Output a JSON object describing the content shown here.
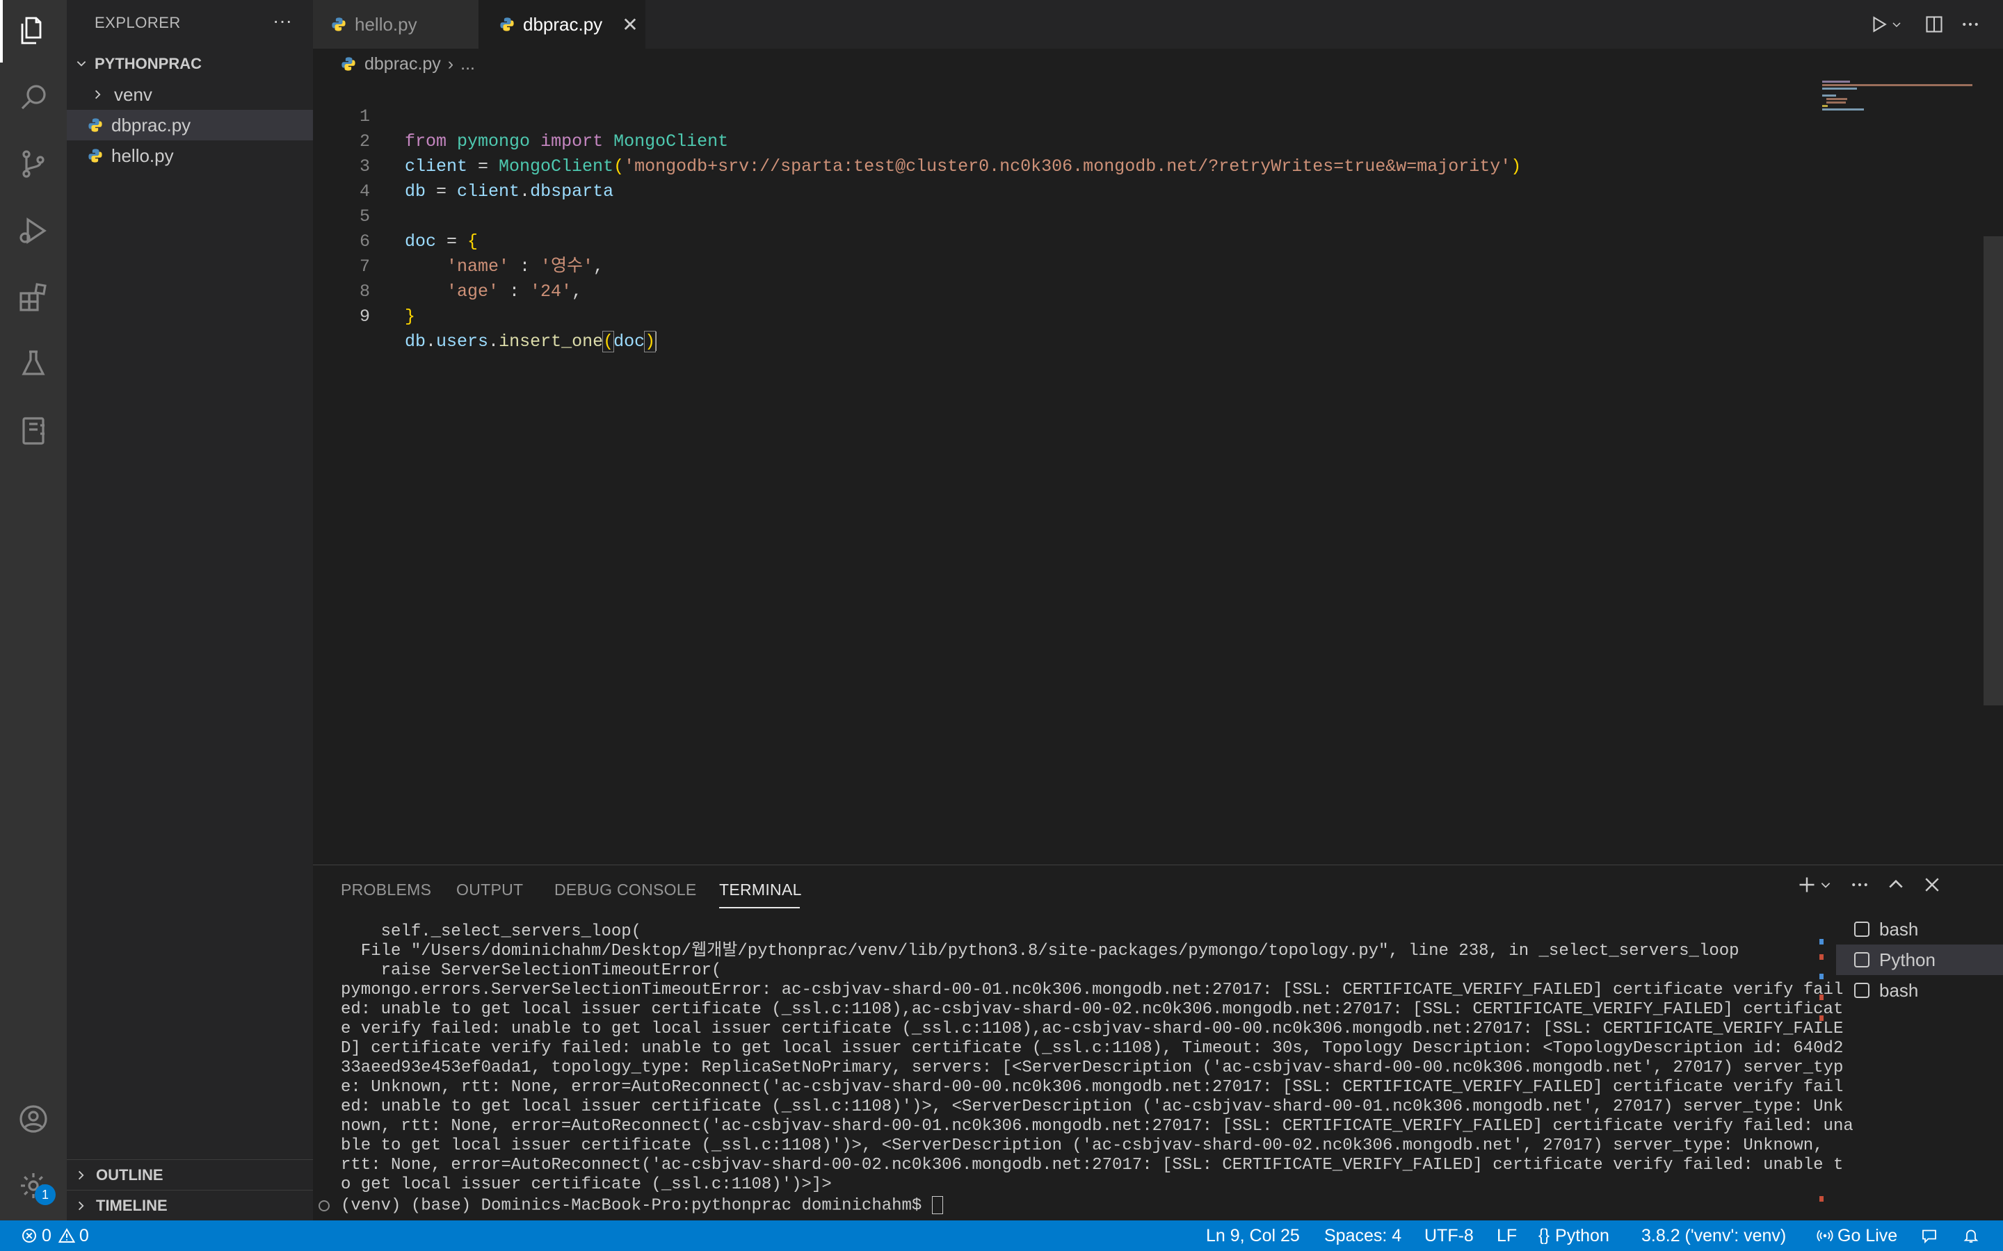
{
  "sidebar": {
    "title": "EXPLORER",
    "more": "···",
    "folder": "PYTHONPRAC",
    "items": [
      {
        "label": "venv",
        "type": "folder"
      },
      {
        "label": "dbprac.py",
        "type": "file"
      },
      {
        "label": "hello.py",
        "type": "file"
      }
    ],
    "outline": "OUTLINE",
    "timeline": "TIMELINE"
  },
  "tabs": [
    {
      "label": "hello.py"
    },
    {
      "label": "dbprac.py",
      "close": "✕"
    }
  ],
  "breadcrumb": {
    "file": "dbprac.py",
    "sep": "›",
    "rest": "..."
  },
  "editor": {
    "line_numbers": [
      "1",
      "2",
      "3",
      "4",
      "5",
      "6",
      "7",
      "8",
      "9"
    ],
    "l1": {
      "kw1": "from",
      "mod": "pymongo",
      "kw2": "import",
      "cls": "MongoClient"
    },
    "l2": {
      "var": "client",
      "eq": " = ",
      "cls": "MongoClient",
      "p1": "(",
      "str": "'mongodb+srv://sparta:test@cluster0.nc0k306.mongodb.net/?retryWrites=true&w=majority'",
      "p2": ")"
    },
    "l3": {
      "var1": "db",
      "eq": " = ",
      "var2": "client",
      "dot": ".",
      "var3": "dbsparta"
    },
    "l5": {
      "var": "doc",
      "eq": " = ",
      "br": "{"
    },
    "l6": {
      "key": "'name'",
      "colon": " : ",
      "val": "'영수'",
      "comma": ","
    },
    "l7": {
      "key": "'age'",
      "colon": " : ",
      "val": "'24'",
      "comma": ","
    },
    "l8": {
      "br": "}"
    },
    "l9": {
      "var1": "db",
      "dot1": ".",
      "var2": "users",
      "dot2": ".",
      "fn": "insert_one",
      "p1": "(",
      "arg": "doc",
      "p2": ")"
    }
  },
  "panel": {
    "tabs": [
      "PROBLEMS",
      "OUTPUT",
      "DEBUG CONSOLE",
      "TERMINAL"
    ],
    "terminal_lines": [
      "    self._select_servers_loop(",
      "  File \"/Users/dominichahm/Desktop/웹개발/pythonprac/venv/lib/python3.8/site-packages/pymongo/topology.py\", line 238, in _select_servers_loop",
      "    raise ServerSelectionTimeoutError(",
      "pymongo.errors.ServerSelectionTimeoutError: ac-csbjvav-shard-00-01.nc0k306.mongodb.net:27017: [SSL: CERTIFICATE_VERIFY_FAILED] certificate verify fail",
      "ed: unable to get local issuer certificate (_ssl.c:1108),ac-csbjvav-shard-00-02.nc0k306.mongodb.net:27017: [SSL: CERTIFICATE_VERIFY_FAILED] certificat",
      "e verify failed: unable to get local issuer certificate (_ssl.c:1108),ac-csbjvav-shard-00-00.nc0k306.mongodb.net:27017: [SSL: CERTIFICATE_VERIFY_FAILE",
      "D] certificate verify failed: unable to get local issuer certificate (_ssl.c:1108), Timeout: 30s, Topology Description: <TopologyDescription id: 640d2",
      "33aeed93e453ef0ada1, topology_type: ReplicaSetNoPrimary, servers: [<ServerDescription ('ac-csbjvav-shard-00-00.nc0k306.mongodb.net', 27017) server_typ",
      "e: Unknown, rtt: None, error=AutoReconnect('ac-csbjvav-shard-00-00.nc0k306.mongodb.net:27017: [SSL: CERTIFICATE_VERIFY_FAILED] certificate verify fail",
      "ed: unable to get local issuer certificate (_ssl.c:1108)')>, <ServerDescription ('ac-csbjvav-shard-00-01.nc0k306.mongodb.net', 27017) server_type: Unk",
      "nown, rtt: None, error=AutoReconnect('ac-csbjvav-shard-00-01.nc0k306.mongodb.net:27017: [SSL: CERTIFICATE_VERIFY_FAILED] certificate verify failed: una",
      "ble to get local issuer certificate (_ssl.c:1108)')>, <ServerDescription ('ac-csbjvav-shard-00-02.nc0k306.mongodb.net', 27017) server_type: Unknown,",
      "rtt: None, error=AutoReconnect('ac-csbjvav-shard-00-02.nc0k306.mongodb.net:27017: [SSL: CERTIFICATE_VERIFY_FAILED] certificate verify failed: unable t",
      "o get local issuer certificate (_ssl.c:1108)')>]>"
    ],
    "prompt": "(venv) (base) Dominics-MacBook-Pro:pythonprac dominichahm$ ",
    "terminals": [
      "bash",
      "Python",
      "bash"
    ]
  },
  "status": {
    "errors": "0",
    "warnings": "0",
    "position": "Ln 9, Col 25",
    "spaces": "Spaces: 4",
    "encoding": "UTF-8",
    "eol": "LF",
    "language": "Python",
    "interpreter": "3.8.2 ('venv': venv)",
    "golive": "Go Live"
  },
  "badge": {
    "settings_count": "1"
  },
  "colors": {
    "accent": "#007acc",
    "activity_bg": "#333333",
    "sidebar_bg": "#252526",
    "editor_bg": "#1e1e1e"
  }
}
